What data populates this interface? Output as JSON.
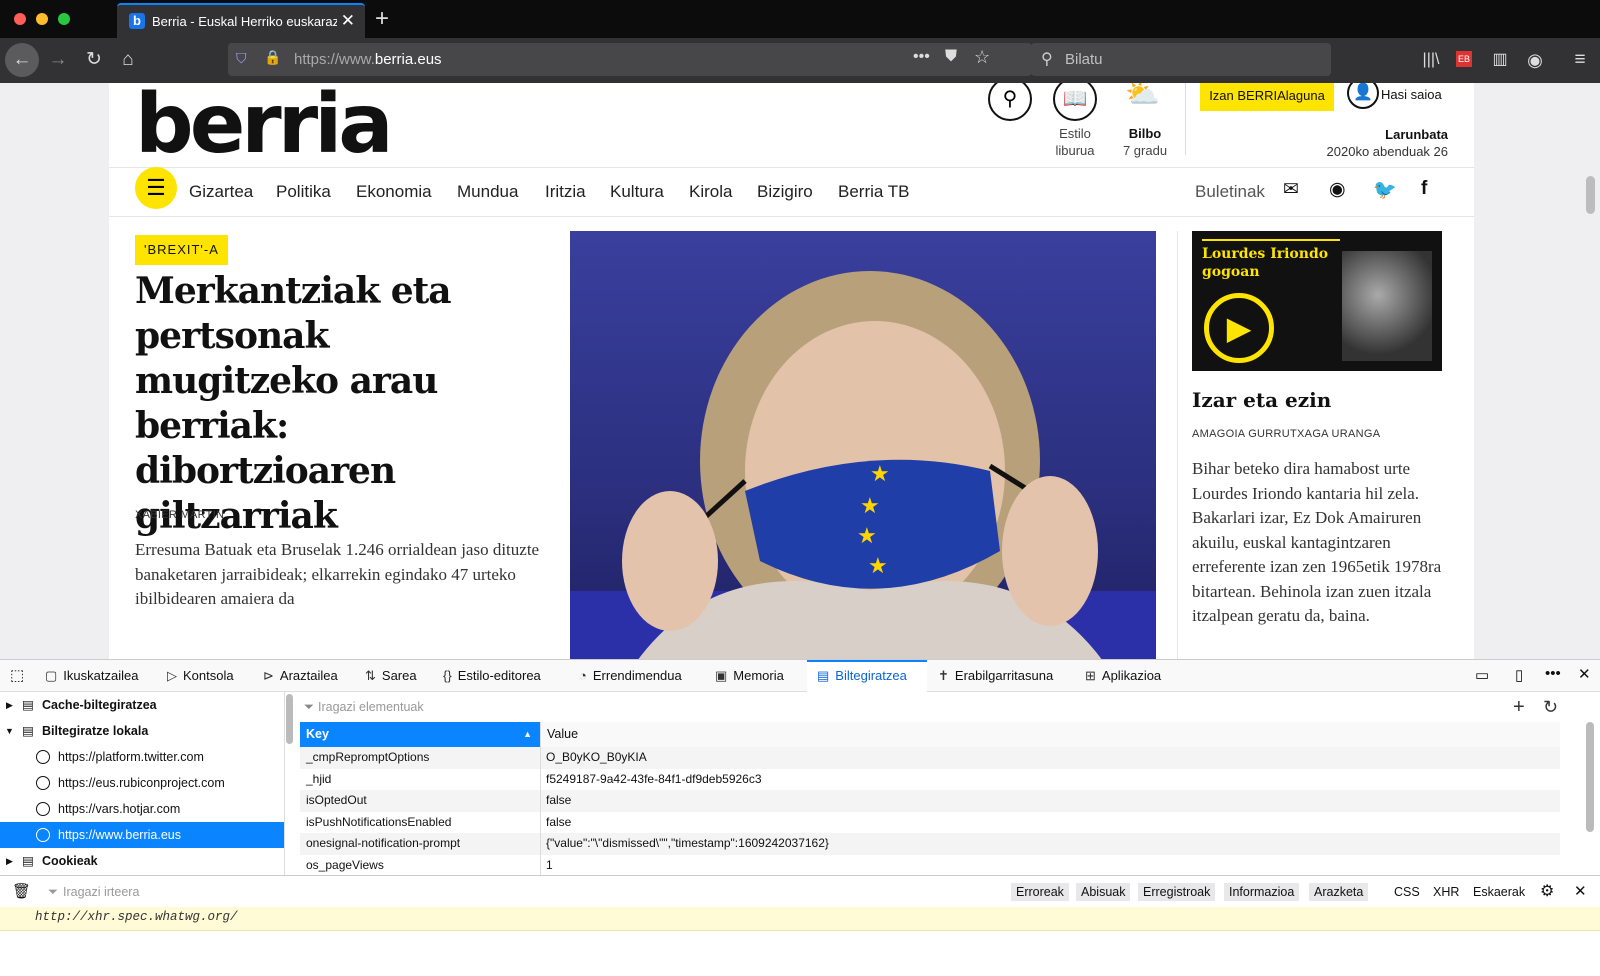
{
  "browser": {
    "tab_title": "Berria - Euskal Herriko euskaraz",
    "tab_favicon": "b",
    "url_prefix": "https://www.",
    "url_domain": "berria.eus",
    "search_placeholder": "Bilatu",
    "accent": "#0a84ff"
  },
  "site": {
    "logo": "berria",
    "estilo": [
      "Estilo",
      "liburua"
    ],
    "weather_city": "Bilbo",
    "weather_temp": "7 gradu",
    "izan": "Izan BERRIAlaguna",
    "hasi": "Hasi saioa",
    "day": "Larunbata",
    "date": "2020ko abenduak 26",
    "nav": [
      "Gizartea",
      "Politika",
      "Ekonomia",
      "Mundua",
      "Iritzia",
      "Kultura",
      "Kirola",
      "Bizigiro",
      "Berria TB"
    ],
    "buletinak": "Buletinak",
    "yellow": "#ffe400"
  },
  "article": {
    "tag": "'BREXIT'-A",
    "headline": "Merkantziak eta pertsonak mugitzeko arau berriak: dibortzioaren giltzarriak",
    "author": "XABIER MARTIN",
    "summary": "Erresuma Batuak eta Bruselak 1.246 orrialdean jaso dituzte banaketaren jarraibideak; elkarrekin egindako 47 urteko ibilbidearen amaiera da"
  },
  "side": {
    "img_title": "Lourdes Iriondo gogoan",
    "title": "Izar eta ezin",
    "author": "AMAGOIA GURRUTXAGA URANGA",
    "body": "Bihar beteko dira hamabost urte Lourdes Iriondo kantaria hil zela. Bakarlari izar, Ez Dok Amairuren akuilu, euskal kantagintzaren erreferente izan zen 1965etik 1978ra bitartean. Behinola izan zuen itzala itzalpean geratu da, baina."
  },
  "devtools": {
    "tabs": [
      "Ikuskatzailea",
      "Kontsola",
      "Araztailea",
      "Sarea",
      "Estilo-editorea",
      "Errendimendua",
      "Memoria",
      "Biltegiratzea",
      "Erabilgarritasuna",
      "Aplikazioa"
    ],
    "tab_icons": [
      "inspector-icon",
      "console-icon",
      "debugger-icon",
      "network-icon",
      "style-editor-icon",
      "performance-icon",
      "memory-icon",
      "storage-icon",
      "accessibility-icon",
      "application-icon"
    ],
    "selected_tab": "Biltegiratzea",
    "tree": {
      "cache": "Cache-biltegiratzea",
      "local": "Biltegiratze lokala",
      "hosts": [
        "https://platform.twitter.com",
        "https://eus.rubiconproject.com",
        "https://vars.hotjar.com",
        "https://www.berria.eus"
      ],
      "cookies": "Cookieak"
    },
    "filter_items": "Iragazi elementuak",
    "col_key": "Key",
    "col_value": "Value",
    "rows": [
      {
        "k": "_cmpRepromptOptions",
        "v": "O_B0yKO_B0yKIA"
      },
      {
        "k": "_hjid",
        "v": "f5249187-9a42-43fe-84f1-df9deb5926c3"
      },
      {
        "k": "isOptedOut",
        "v": "false"
      },
      {
        "k": "isPushNotificationsEnabled",
        "v": "false"
      },
      {
        "k": "onesignal-notification-prompt",
        "v": "{\"value\":\"\\\"dismissed\\\"\",\"timestamp\":1609242037162}"
      },
      {
        "k": "os_pageViews",
        "v": "1"
      }
    ],
    "filter_output": "Iragazi irteera",
    "filters": [
      "Erroreak",
      "Abisuak",
      "Erregistroak",
      "Informazioa",
      "Arazketa"
    ],
    "types": [
      "CSS",
      "XHR",
      "Eskaerak"
    ],
    "warn_text": "http://xhr.spec.whatwg.org/"
  }
}
